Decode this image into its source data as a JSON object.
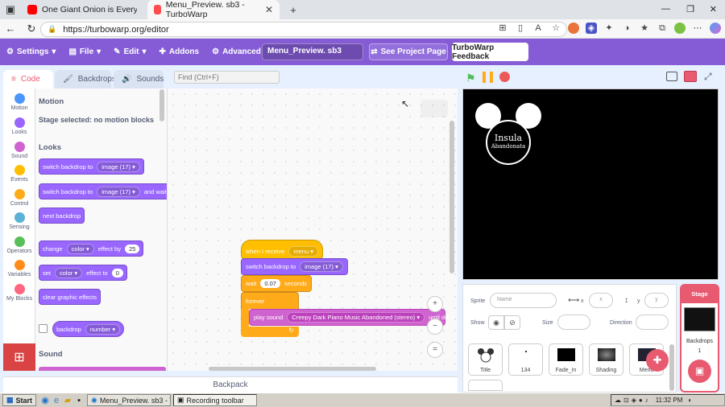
{
  "browser": {
    "tabs": [
      {
        "title": "One Giant Onion is Everything W",
        "color": "#ff0000"
      },
      {
        "title": "Menu_Preview. sb3 - TurboWarp",
        "color": "#ff4c4c"
      }
    ],
    "new_tab": "+",
    "url": "https://turbowarp.org/editor"
  },
  "menubar": {
    "settings": "Settings",
    "file": "File",
    "edit": "Edit",
    "addons": "Addons",
    "advanced": "Advanced",
    "project_title": "Menu_Preview. sb3",
    "see_project": "See Project Page",
    "feedback": "TurboWarp Feedback"
  },
  "editor_tabs": {
    "code": "Code",
    "backdrops": "Backdrops",
    "sounds": "Sounds"
  },
  "find_placeholder": "Find (Ctrl+F)",
  "categories": [
    {
      "label": "Motion",
      "color": "#4c97ff"
    },
    {
      "label": "Looks",
      "color": "#9966ff"
    },
    {
      "label": "Sound",
      "color": "#cf63cf"
    },
    {
      "label": "Events",
      "color": "#ffbf00"
    },
    {
      "label": "Control",
      "color": "#ffab19"
    },
    {
      "label": "Sensing",
      "color": "#5cb1d6"
    },
    {
      "label": "Operators",
      "color": "#59c059"
    },
    {
      "label": "Variables",
      "color": "#ff8c1a"
    },
    {
      "label": "My Blocks",
      "color": "#ff6680"
    }
  ],
  "palette": {
    "motion_head": "Motion",
    "motion_note": "Stage selected: no motion blocks",
    "looks_head": "Looks",
    "sound_head": "Sound",
    "b1": "switch backdrop to",
    "b1_val": "image (17)",
    "b2": "switch backdrop to",
    "b2_val": "image (17)",
    "b2_tail": "and wait",
    "b3": "next backdrop",
    "b4": "change",
    "b4_val": "color",
    "b4_mid": "effect by",
    "b4_num": "25",
    "b5": "set",
    "b5_val": "color",
    "b5_mid": "effect to",
    "b5_num": "0",
    "b6": "clear graphic effects",
    "b7": "backdrop",
    "b7_val": "number"
  },
  "script": {
    "hat": "when I receive",
    "hat_val": "menu",
    "s1": "switch backdrop to",
    "s1_val": "image (17)",
    "s2": "wait",
    "s2_val": "0.07",
    "s2_tail": "seconds",
    "loop": "forever",
    "s3": "play sound",
    "s3_val": "Creepy Dark Piano Music  Abandoned (stereo)",
    "s3_tail": "until done",
    "zoom_in": "+",
    "zoom_out": "−",
    "zoom_reset": "="
  },
  "backpack": "Backpack",
  "stage_logo": {
    "line1": "Insula",
    "line2": "Abandonata"
  },
  "sprite_info": {
    "sprite_label": "Sprite",
    "name_placeholder": "Name",
    "x_label": "x",
    "x_placeholder": "x",
    "y_label": "y",
    "y_placeholder": "y",
    "show_label": "Show",
    "size_label": "Size",
    "direction_label": "Direction"
  },
  "sprites": [
    "Title",
    "134",
    "Fade_In",
    "Shading",
    "Menu"
  ],
  "stage_panel": {
    "title": "Stage",
    "backdrops_label": "Backdrops",
    "backdrops_count": "1"
  },
  "taskbar": {
    "start": "Start",
    "item1": "Menu_Preview. sb3 - Turb...",
    "item2": "Recording toolbar",
    "clock": "11:32 PM"
  }
}
